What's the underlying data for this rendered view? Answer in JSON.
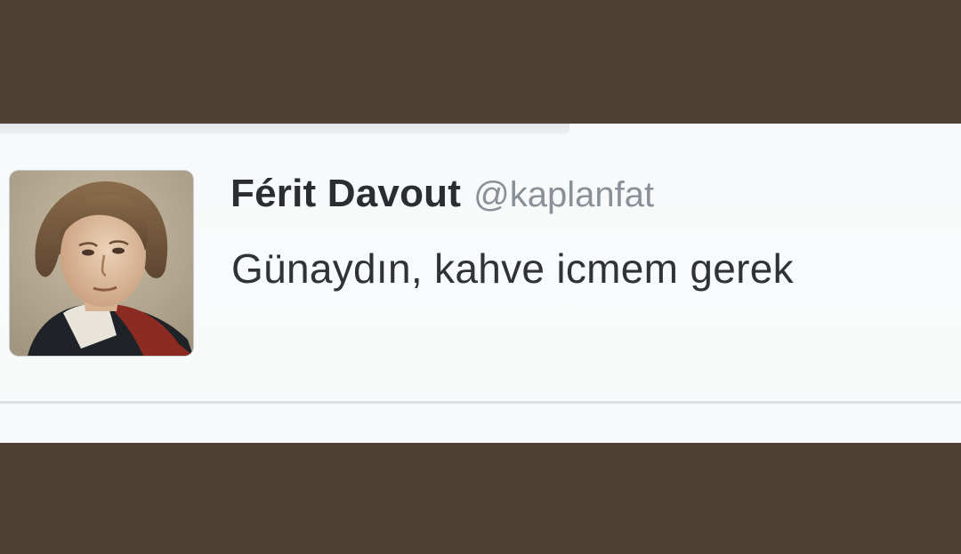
{
  "tweet": {
    "display_name": "Férit Davout",
    "handle": "@kaplanfat",
    "text": "Günaydın, kahve icmem gerek",
    "avatar": "portrait-avatar"
  },
  "colors": {
    "background_band": "#4e4133",
    "card_background": "#f7f9fa",
    "name_color": "#2a2d31",
    "handle_color": "#8a9097",
    "text_color": "#2f3337"
  }
}
